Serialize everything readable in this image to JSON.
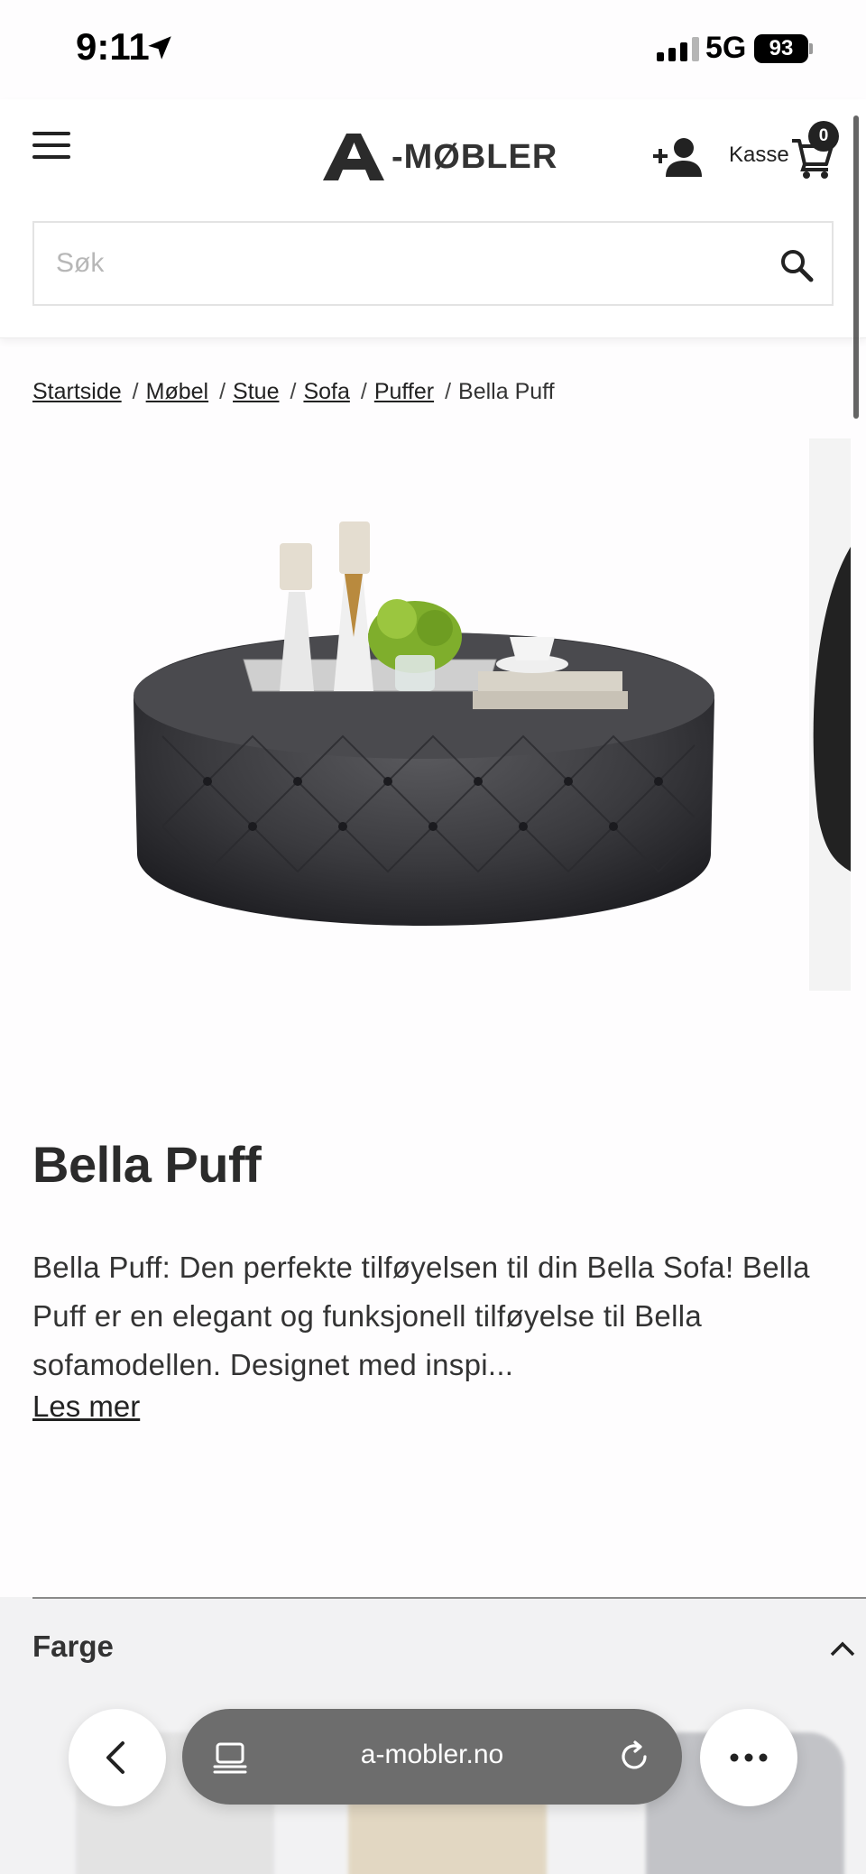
{
  "status_bar": {
    "time": "9:11",
    "network": "5G",
    "battery": "93"
  },
  "header": {
    "logo_text": "-MØBLER",
    "cart_label": "Kasse",
    "cart_count": "0",
    "search": {
      "placeholder": "Søk",
      "value": ""
    }
  },
  "breadcrumb": {
    "links": [
      "Startside",
      "Møbel",
      "Stue",
      "Sofa",
      "Puffer"
    ],
    "separator": "/",
    "current": "Bella Puff"
  },
  "product": {
    "title": "Bella Puff",
    "description": "Bella Puff: Den perfekte tilføyelsen til din Bella Sofa! Bella Puff er en elegant og funksjonell tilføyelse til Bella sofamodellen. Designet med inspi...",
    "read_more": "Les mer"
  },
  "accordion": {
    "title": "Farge"
  },
  "browser": {
    "url": "a-mobler.no"
  },
  "icons": {
    "menu": "hamburger-icon",
    "account": "add-user-icon",
    "cart": "shopping-cart-icon",
    "search": "search-icon",
    "back": "chevron-left-icon",
    "tabs": "tabs-icon",
    "reload": "reload-icon",
    "more": "more-dots-icon",
    "accordion": "chevron-up-icon"
  },
  "colors": {
    "text": "#2a2a2a",
    "url_pill": "#6d6d6d",
    "accordion_bg": "#f2f2f3"
  }
}
